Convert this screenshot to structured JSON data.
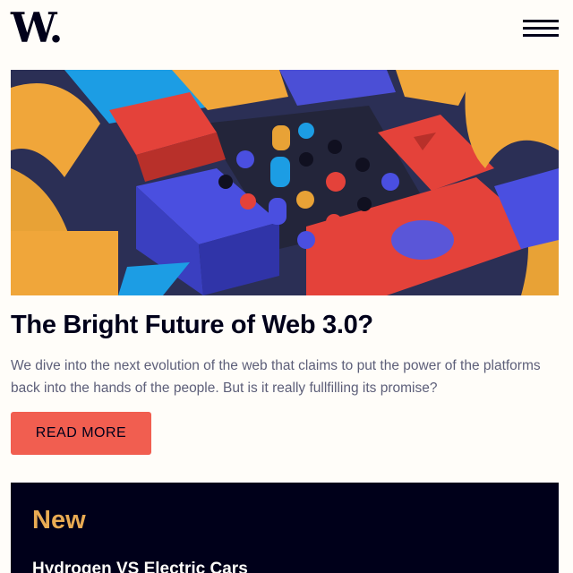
{
  "header": {
    "logo": "W.",
    "menu_icon": "hamburger-menu-icon"
  },
  "hero": {
    "image_description_icon": "colorful-3d-blocks-image"
  },
  "article": {
    "title": "The Bright Future of Web 3.0?",
    "description": "We dive into the next evolution of the web that claims to put the power of the platforms back into the hands of the people. But is it really fullfilling its promise?",
    "button_label": "READ MORE"
  },
  "new_section": {
    "heading": "New",
    "items": [
      {
        "title": "Hydrogen VS Electric Cars"
      }
    ]
  },
  "colors": {
    "accent_red": "#f15e50",
    "accent_orange": "#e9ab53",
    "dark_navy": "#00001a",
    "off_white": "#fffdf9",
    "text_gray": "#5d5f79"
  }
}
